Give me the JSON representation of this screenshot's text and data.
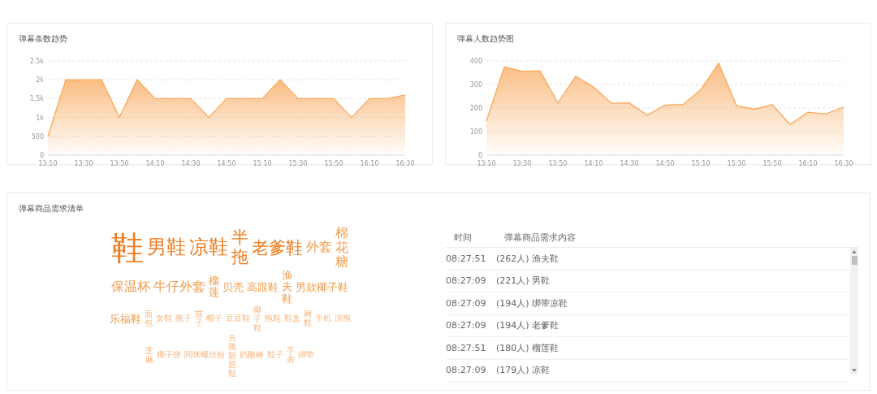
{
  "trend_panels": [
    {
      "title": "弹幕条数趋势",
      "chart_data": {
        "type": "area",
        "grid": true,
        "categories": [
          "13:10",
          null,
          "13:30",
          null,
          "13:50",
          null,
          "14:10",
          null,
          "14:30",
          null,
          "14:50",
          null,
          "15:10",
          null,
          "15:30",
          null,
          "15:50",
          null,
          "16:10",
          null,
          "16:30"
        ],
        "series": [
          {
            "color": "#f9a85a",
            "values": [
              500,
              2000,
              2000,
              2000,
              1000,
              2000,
              1500,
              1500,
              1500,
              1000,
              1500,
              1500,
              1500,
              2000,
              1500,
              1500,
              1500,
              1000,
              1500,
              1500,
              1600
            ]
          }
        ],
        "ylim": [
          0,
          2500
        ],
        "yticks": [
          {
            "value": 0,
            "label": "0"
          },
          {
            "value": 500,
            "label": "500"
          },
          {
            "value": 1000,
            "label": "1k"
          },
          {
            "value": 1500,
            "label": "1.5k"
          },
          {
            "value": 2000,
            "label": "2k"
          },
          {
            "value": 2500,
            "label": "2.5k"
          }
        ]
      }
    },
    {
      "title": "弹幕人数趋势图",
      "chart_data": {
        "type": "area",
        "grid": true,
        "categories": [
          "13:10",
          null,
          "13:30",
          null,
          "13:50",
          null,
          "14:10",
          null,
          "14:30",
          null,
          "14:50",
          null,
          "15:10",
          null,
          "15:30",
          null,
          "15:50",
          null,
          "16:10",
          null,
          "16:30"
        ],
        "series": [
          {
            "color": "#f9a85a",
            "values": [
              145,
              375,
              355,
              358,
              222,
              335,
              290,
              220,
              222,
              170,
              212,
              215,
              278,
              390,
              210,
              195,
              215,
              130,
              182,
              175,
              205
            ]
          }
        ],
        "ylim": [
          0,
          400
        ],
        "yticks": [
          {
            "value": 0,
            "label": "0"
          },
          {
            "value": 100,
            "label": "100"
          },
          {
            "value": 200,
            "label": "200"
          },
          {
            "value": 300,
            "label": "300"
          },
          {
            "value": 400,
            "label": "400"
          }
        ]
      }
    }
  ],
  "demand_panel": {
    "title": "弹幕商品需求清单",
    "word_cloud": [
      "鞋",
      "男鞋",
      "凉鞋",
      "半拖",
      "老爹鞋",
      "外套",
      "棉花糖",
      "保温杯",
      "牛仔外套",
      "榴莲",
      "贝壳",
      "高跟鞋",
      "渔夫鞋",
      "男款椰子鞋",
      "乐福鞋",
      "面包",
      "女鞋",
      "靴子",
      "茄子",
      "帽子",
      "豆豆鞋",
      "椰子鞋",
      "拖鞋",
      "鞋盒",
      "网鞋",
      "手机",
      "凉拖",
      "芝麻",
      "椰子饼",
      "阿咪螺丝粉",
      "古驰脏脏鞋",
      "奶酪棒",
      "鞋子",
      "手表",
      "绑带"
    ],
    "columns": [
      "时间",
      "弹幕商品需求内容"
    ],
    "rows": [
      {
        "time": "08:27:51",
        "content": "(262人) 渔夫鞋"
      },
      {
        "time": "08:27:09",
        "content": "(221人) 男鞋"
      },
      {
        "time": "08:27:09",
        "content": "(194人) 绑带凉鞋"
      },
      {
        "time": "08:27:09",
        "content": "(194人) 老爹鞋"
      },
      {
        "time": "08:27:51",
        "content": "(180人) 榴莲鞋"
      },
      {
        "time": "08:27:09",
        "content": "(179人) 凉鞋"
      }
    ]
  }
}
